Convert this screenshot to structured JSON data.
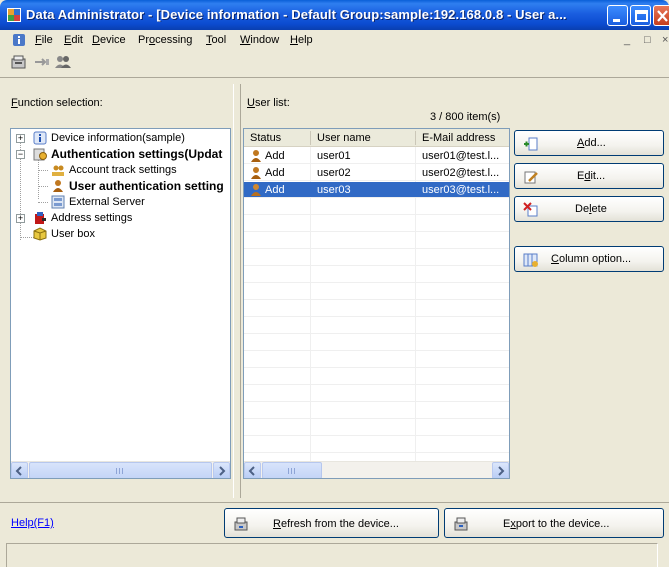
{
  "window": {
    "title": "Data Administrator - [Device information - Default Group:sample:192.168.0.8 - User a...",
    "colors": {
      "titlebar": "#0a5fd8",
      "selection": "#316ac5",
      "link": "#0000ff"
    }
  },
  "menu": {
    "items": [
      {
        "label": "File"
      },
      {
        "label": "Edit"
      },
      {
        "label": "Device"
      },
      {
        "label": "Processing"
      },
      {
        "label": "Tool"
      },
      {
        "label": "Window"
      },
      {
        "label": "Help"
      }
    ]
  },
  "left": {
    "label": "Function selection:",
    "tree": [
      {
        "label": "Device information(sample)",
        "icon": "info-icon"
      },
      {
        "label": "Authentication settings(Updat",
        "icon": "auth-settings-icon"
      },
      {
        "label": "Account track settings",
        "icon": "account-track-icon"
      },
      {
        "label": "User authentication setting",
        "icon": "user-icon"
      },
      {
        "label": "External Server",
        "icon": "server-icon"
      },
      {
        "label": "Address settings",
        "icon": "address-book-icon"
      },
      {
        "label": "User box",
        "icon": "box-icon"
      }
    ]
  },
  "list": {
    "label": "User list:",
    "count": "3 / 800 item(s)",
    "columns": [
      "Status",
      "User name",
      "E-Mail address"
    ],
    "rows": [
      {
        "status": "Add",
        "user": "user01",
        "email": "user01@test.l..."
      },
      {
        "status": "Add",
        "user": "user02",
        "email": "user02@test.l..."
      },
      {
        "status": "Add",
        "user": "user03",
        "email": "user03@test.l..."
      }
    ]
  },
  "actions": {
    "add": "Add...",
    "edit": "Edit...",
    "delete": "Delete",
    "column_option": "Column option..."
  },
  "footer": {
    "help": "Help(F1)",
    "refresh": "Refresh from the device...",
    "export": "Export to the device..."
  }
}
